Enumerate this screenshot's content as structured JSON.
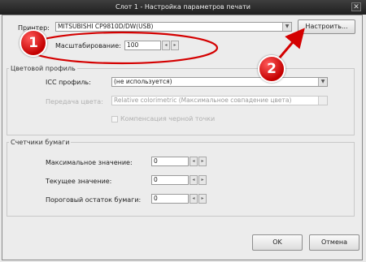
{
  "window": {
    "title": "Слот 1 - Настройка параметров печати",
    "close_glyph": "✕"
  },
  "printer": {
    "label": "Принтер:",
    "value": "MITSUBISHI CP9810D/DW(USB)",
    "configure_button": "Настроить..."
  },
  "scaling": {
    "label": "Масштабирование:",
    "value": "100"
  },
  "color_profile": {
    "group_title": "Цветовой профиль",
    "icc_label": "ICC профиль:",
    "icc_value": "(не используется)",
    "render_label": "Передача цвета:",
    "render_value": "Relative colorimetric (Максимальное совпадение цвета)",
    "black_point_label": "Компенсация черной точки",
    "black_point_checked": false
  },
  "paper_counters": {
    "group_title": "Счетчики бумаги",
    "rows": [
      {
        "label": "Максимальное значение:",
        "value": "0"
      },
      {
        "label": "Текущее значение:",
        "value": "0"
      },
      {
        "label": "Пороговый остаток бумаги:",
        "value": "0"
      }
    ]
  },
  "footer": {
    "ok_label": "OK",
    "cancel_label": "Отмена"
  },
  "annotations": {
    "badge_1": "1",
    "badge_2": "2",
    "accent_color": "#d40000"
  },
  "glyphs": {
    "dropdown": "▼",
    "spin_left": "◂",
    "spin_right": "▸"
  }
}
